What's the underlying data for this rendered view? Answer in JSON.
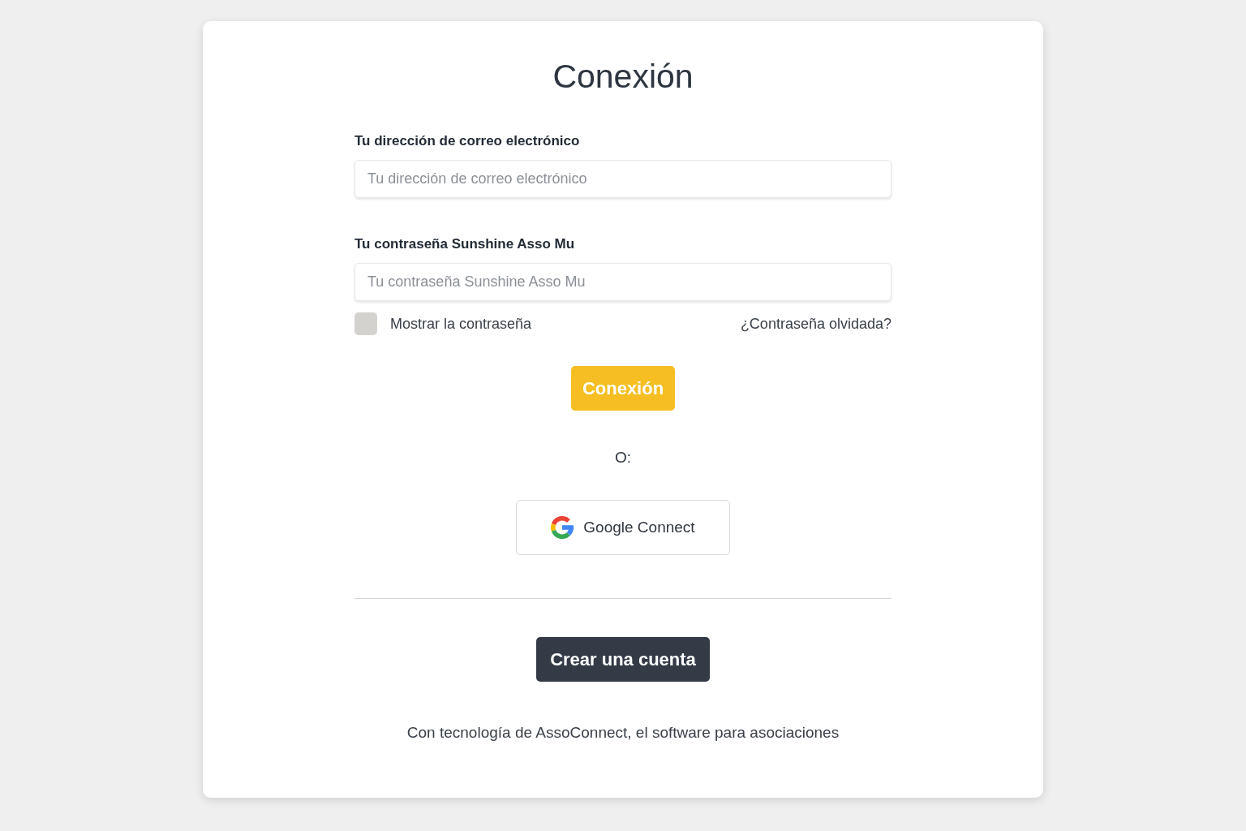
{
  "title": "Conexión",
  "fields": [
    {
      "label": "Tu dirección de correo electrónico",
      "placeholder": "Tu dirección de correo electrónico"
    },
    {
      "label": "Tu contraseña Sunshine Asso Mu",
      "placeholder": "Tu contraseña Sunshine Asso Mu"
    }
  ],
  "show_password": {
    "label": "Mostrar la contraseña",
    "checked": false
  },
  "forgot_link": "¿Contraseña olvidada?",
  "login_button": "Conexión",
  "separator": "O:",
  "google_button": "Google Connect",
  "create_account_button": "Crear una cuenta",
  "footer": "Con tecnología de AssoConnect, el software para asociaciones"
}
